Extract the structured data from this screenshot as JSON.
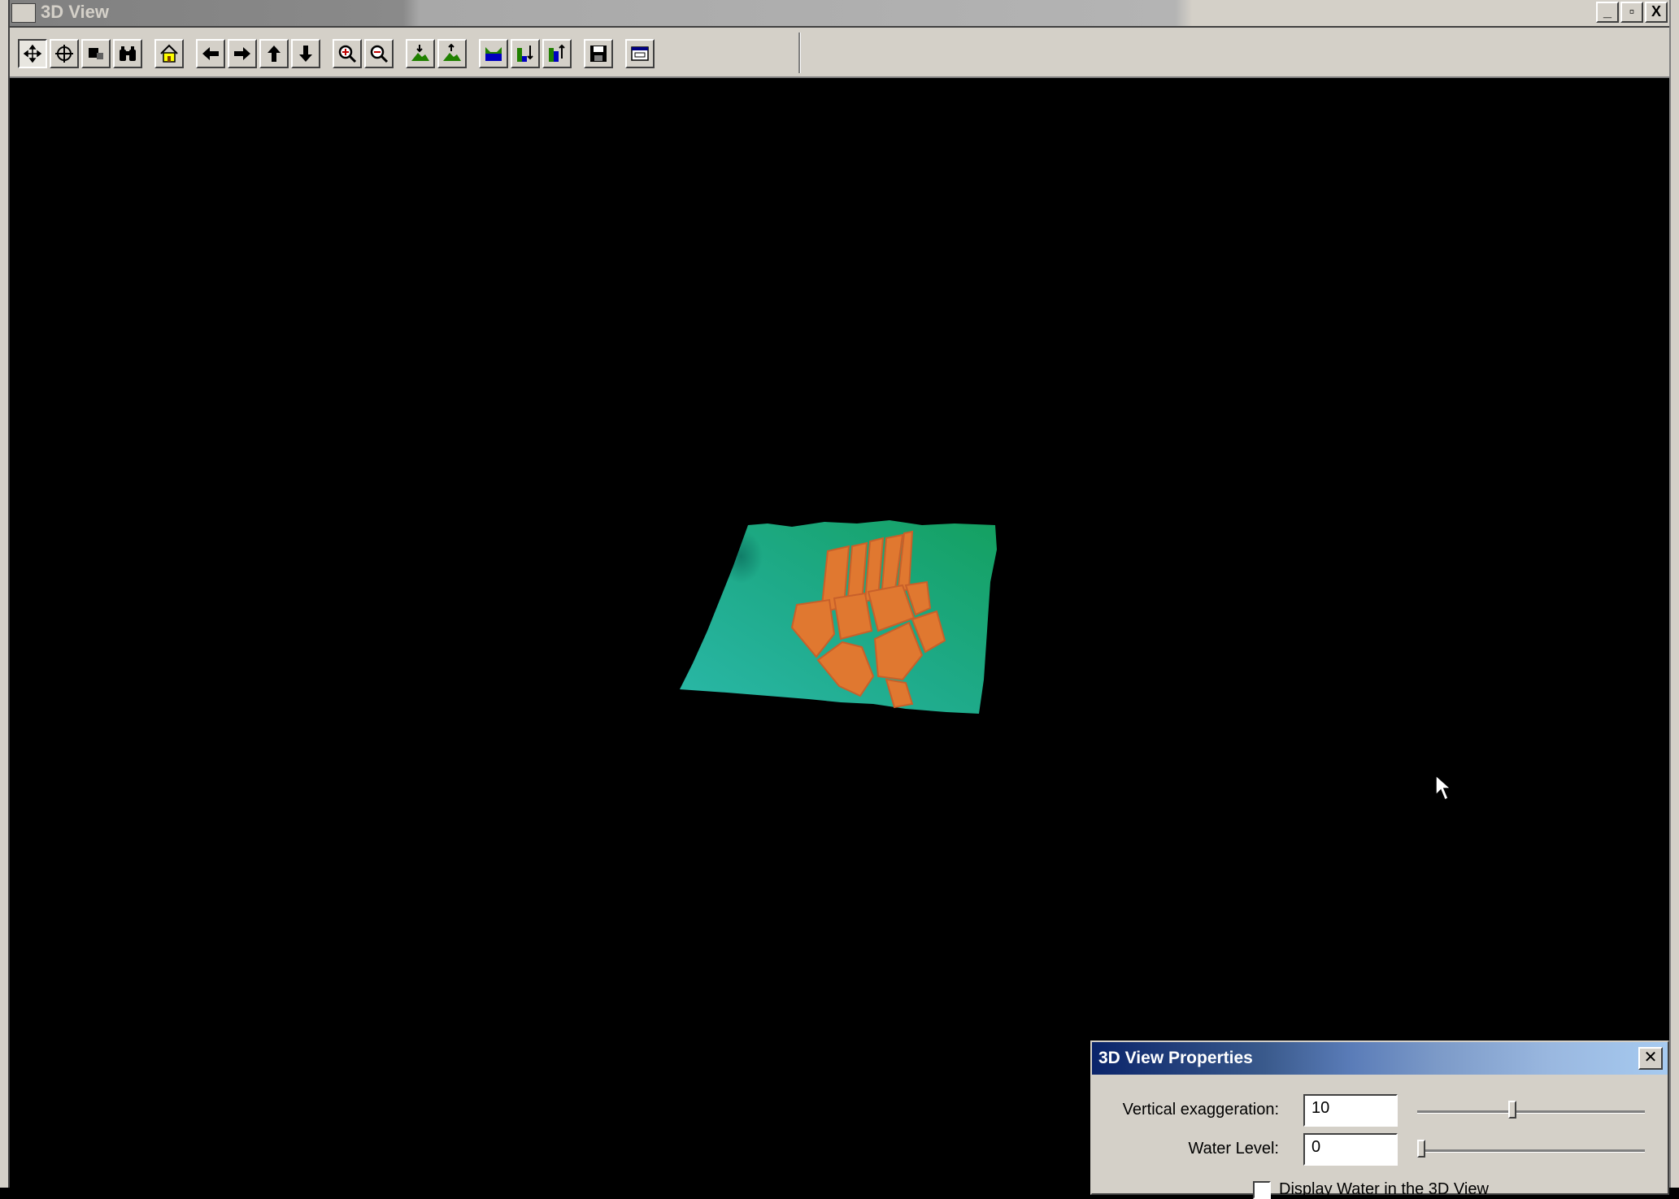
{
  "window": {
    "title": "3D View",
    "minimize_glyph": "_",
    "restore_glyph": "▫",
    "close_glyph": "X"
  },
  "toolbar": {
    "buttons": [
      {
        "icon": "navigate-icon",
        "pressed": true
      },
      {
        "icon": "pan-icon"
      },
      {
        "icon": "zoom-box-icon"
      },
      {
        "icon": "binoculars-icon"
      },
      {
        "icon": "home-icon"
      },
      {
        "icon": "arrow-left-icon"
      },
      {
        "icon": "arrow-right-icon"
      },
      {
        "icon": "arrow-up-icon"
      },
      {
        "icon": "arrow-down-icon"
      },
      {
        "icon": "zoom-in-icon"
      },
      {
        "icon": "zoom-out-icon"
      },
      {
        "icon": "terrain-lower-icon"
      },
      {
        "icon": "terrain-raise-icon"
      },
      {
        "icon": "water-icon"
      },
      {
        "icon": "water-lower-icon"
      },
      {
        "icon": "water-raise-icon"
      },
      {
        "icon": "save-icon"
      },
      {
        "icon": "properties-icon"
      }
    ]
  },
  "properties_dialog": {
    "title": "3D View Properties",
    "close_glyph": "✕",
    "vertical_exaggeration": {
      "label": "Vertical exaggeration:",
      "value": "10",
      "slider_fraction": 0.4
    },
    "water_level": {
      "label": "Water Level:",
      "value": "0",
      "slider_fraction": 0.0
    },
    "display_water": {
      "label": "Display Water in the 3D View",
      "checked": false
    }
  },
  "colors": {
    "terrain_low": "#2ab8a8",
    "terrain_high": "#14a060",
    "parcels": "#e07830"
  }
}
